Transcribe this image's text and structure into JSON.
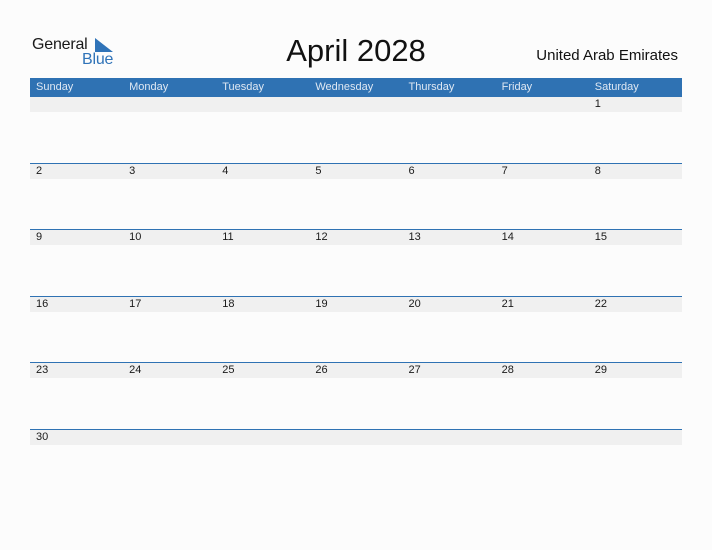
{
  "logo": {
    "line1": "General",
    "line2": "Blue",
    "icon": "blue-triangle-icon",
    "accent": "#2f73b8"
  },
  "title": "April 2028",
  "country": "United Arab Emirates",
  "colors": {
    "header_bg": "#2f72b3",
    "day_strip_bg": "#f0f0f0"
  },
  "weekdays": [
    "Sunday",
    "Monday",
    "Tuesday",
    "Wednesday",
    "Thursday",
    "Friday",
    "Saturday"
  ],
  "weeks": [
    [
      "",
      "",
      "",
      "",
      "",
      "",
      "1"
    ],
    [
      "2",
      "3",
      "4",
      "5",
      "6",
      "7",
      "8"
    ],
    [
      "9",
      "10",
      "11",
      "12",
      "13",
      "14",
      "15"
    ],
    [
      "16",
      "17",
      "18",
      "19",
      "20",
      "21",
      "22"
    ],
    [
      "23",
      "24",
      "25",
      "26",
      "27",
      "28",
      "29"
    ],
    [
      "30",
      "",
      "",
      "",
      "",
      "",
      ""
    ]
  ]
}
